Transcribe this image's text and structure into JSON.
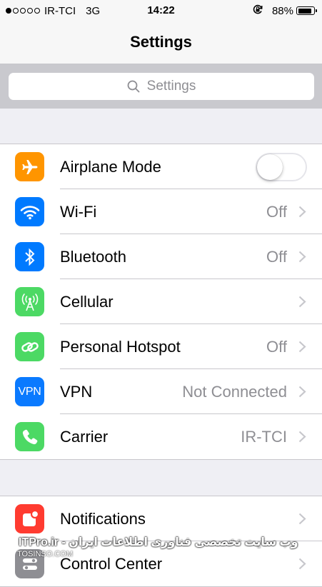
{
  "status_bar": {
    "carrier": "IR-TCI",
    "network": "3G",
    "time": "14:22",
    "battery_percent_text": "88%",
    "battery_level": 0.88,
    "signal_bars_filled": 1,
    "signal_bars_total": 5
  },
  "nav": {
    "title": "Settings"
  },
  "search": {
    "placeholder": "Settings"
  },
  "group1": {
    "rows": [
      {
        "label": "Airplane Mode",
        "value": "",
        "icon": "airplane-icon",
        "color": "#ff9500",
        "toggle_on": false
      },
      {
        "label": "Wi-Fi",
        "value": "Off",
        "icon": "wifi-icon",
        "color": "#007aff"
      },
      {
        "label": "Bluetooth",
        "value": "Off",
        "icon": "bluetooth-icon",
        "color": "#007aff"
      },
      {
        "label": "Cellular",
        "value": "",
        "icon": "cellular-antenna-icon",
        "color": "#4cd964"
      },
      {
        "label": "Personal Hotspot",
        "value": "Off",
        "icon": "hotspot-chain-icon",
        "color": "#4cd964"
      },
      {
        "label": "VPN",
        "value": "Not Connected",
        "icon": "vpn-icon",
        "icon_text": "VPN",
        "color": "#0a7aff"
      },
      {
        "label": "Carrier",
        "value": "IR-TCI",
        "icon": "phone-icon",
        "color": "#4cd964"
      }
    ]
  },
  "group2": {
    "rows": [
      {
        "label": "Notifications",
        "icon": "notifications-icon",
        "color": "#ff3b30"
      },
      {
        "label": "Control Center",
        "icon": "control-center-icon",
        "color": "#8e8e93"
      }
    ]
  },
  "watermark": {
    "text": "ITPro.ir - وب سایت تخصصی فناوری اطلاعات ایران",
    "small_text": "TOSINSO.COM"
  }
}
